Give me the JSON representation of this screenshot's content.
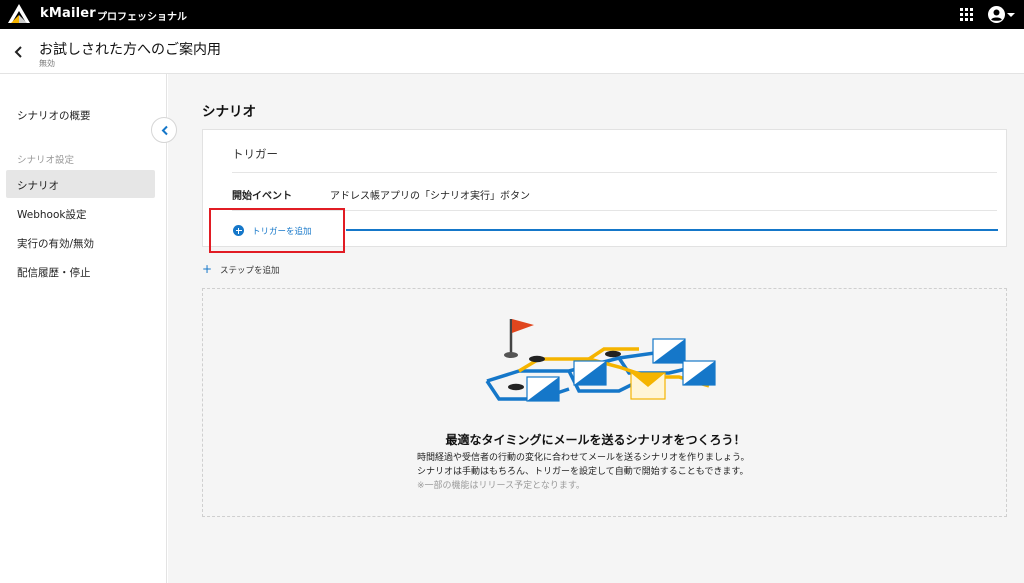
{
  "app": {
    "brand": "kMailer",
    "plan": "プロフェッショナル",
    "icons": {
      "logo": "kmailer-logo-icon",
      "apps": "apps-grid-icon",
      "account": "account-circle-icon"
    }
  },
  "header": {
    "title": "お試しされた方へのご案内用",
    "status": "無効"
  },
  "sidebar": {
    "overview": "シナリオの概要",
    "section": "シナリオ設定",
    "items": [
      {
        "label": "シナリオ",
        "active": true
      },
      {
        "label": "Webhook設定",
        "active": false
      },
      {
        "label": "実行の有効/無効",
        "active": false
      },
      {
        "label": "配信履歴・停止",
        "active": false
      }
    ]
  },
  "main": {
    "section_title": "シナリオ",
    "trigger": {
      "label": "トリガー",
      "event_label": "開始イベント",
      "event_value": "アドレス帳アプリの「シナリオ実行」ボタン",
      "add_trigger": "トリガーを追加"
    },
    "add_step": "ステップを追加",
    "empty": {
      "heading": "最適なタイミングにメールを送るシナリオをつくろう！",
      "line1": "時間経過や受信者の行動の変化に合わせてメールを送るシナリオを作りましょう。",
      "line2": "シナリオは手動はもちろん、トリガーを設定して自動で開始することもできます。",
      "note": "※一部の機能はリリース予定となります。"
    }
  },
  "colors": {
    "accent": "#1577c9",
    "highlight": "#e11c24",
    "flag": "#e0461e",
    "path_yellow": "#f5b400"
  }
}
